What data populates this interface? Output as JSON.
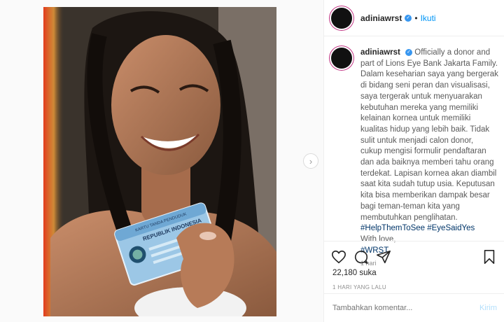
{
  "post": {
    "username": "adiniawrst",
    "verified_mark": "✓",
    "separator": "•",
    "follow_label": "Ikuti",
    "caption_lines": [
      "Officially a donor and",
      "part of Lions Eye Bank Jakarta Family.",
      "Dalam keseharian saya yang bergerak",
      "di bidang seni peran dan visualisasi,",
      "saya tergerak untuk menyuarakan",
      "kebutuhan mereka yang memiliki",
      "kelainan kornea untuk memiliki",
      "kualitas hidup yang lebih baik. Tidak",
      "sulit untuk menjadi calon donor,",
      "cukup mengisi formulir pendaftaran",
      "dan ada baiknya memberi tahu orang",
      "terdekat. Lapisan kornea akan diambil",
      "saat kita sudah tutup usia. Keputusan",
      "kita bisa memberikan dampak besar",
      "bagi teman-teman kita yang",
      "membutuhkan penglihatan."
    ],
    "hashtags_line": "#HelpThemToSee #EyeSaidYes",
    "closing": "With love,",
    "closing_tag": "#WRST",
    "caption_age": "1 hari",
    "likes": "22,180 suka",
    "timestamp": "1 HARI YANG LALU",
    "comment_placeholder": "Tambahkan komentar...",
    "post_button": "Kirim",
    "next_arrow": "›"
  },
  "photo": {
    "card_title": "KARTU TANDA PENDUDUK",
    "card_subtitle": "REPUBLIK INDONESIA"
  },
  "colors": {
    "accent": "#0095f6",
    "tag": "#003569",
    "avatar_ring": "#c13584"
  },
  "icons": [
    "heart-icon",
    "comment-icon",
    "share-icon",
    "bookmark-icon",
    "verified-icon",
    "chevron-right-icon"
  ]
}
